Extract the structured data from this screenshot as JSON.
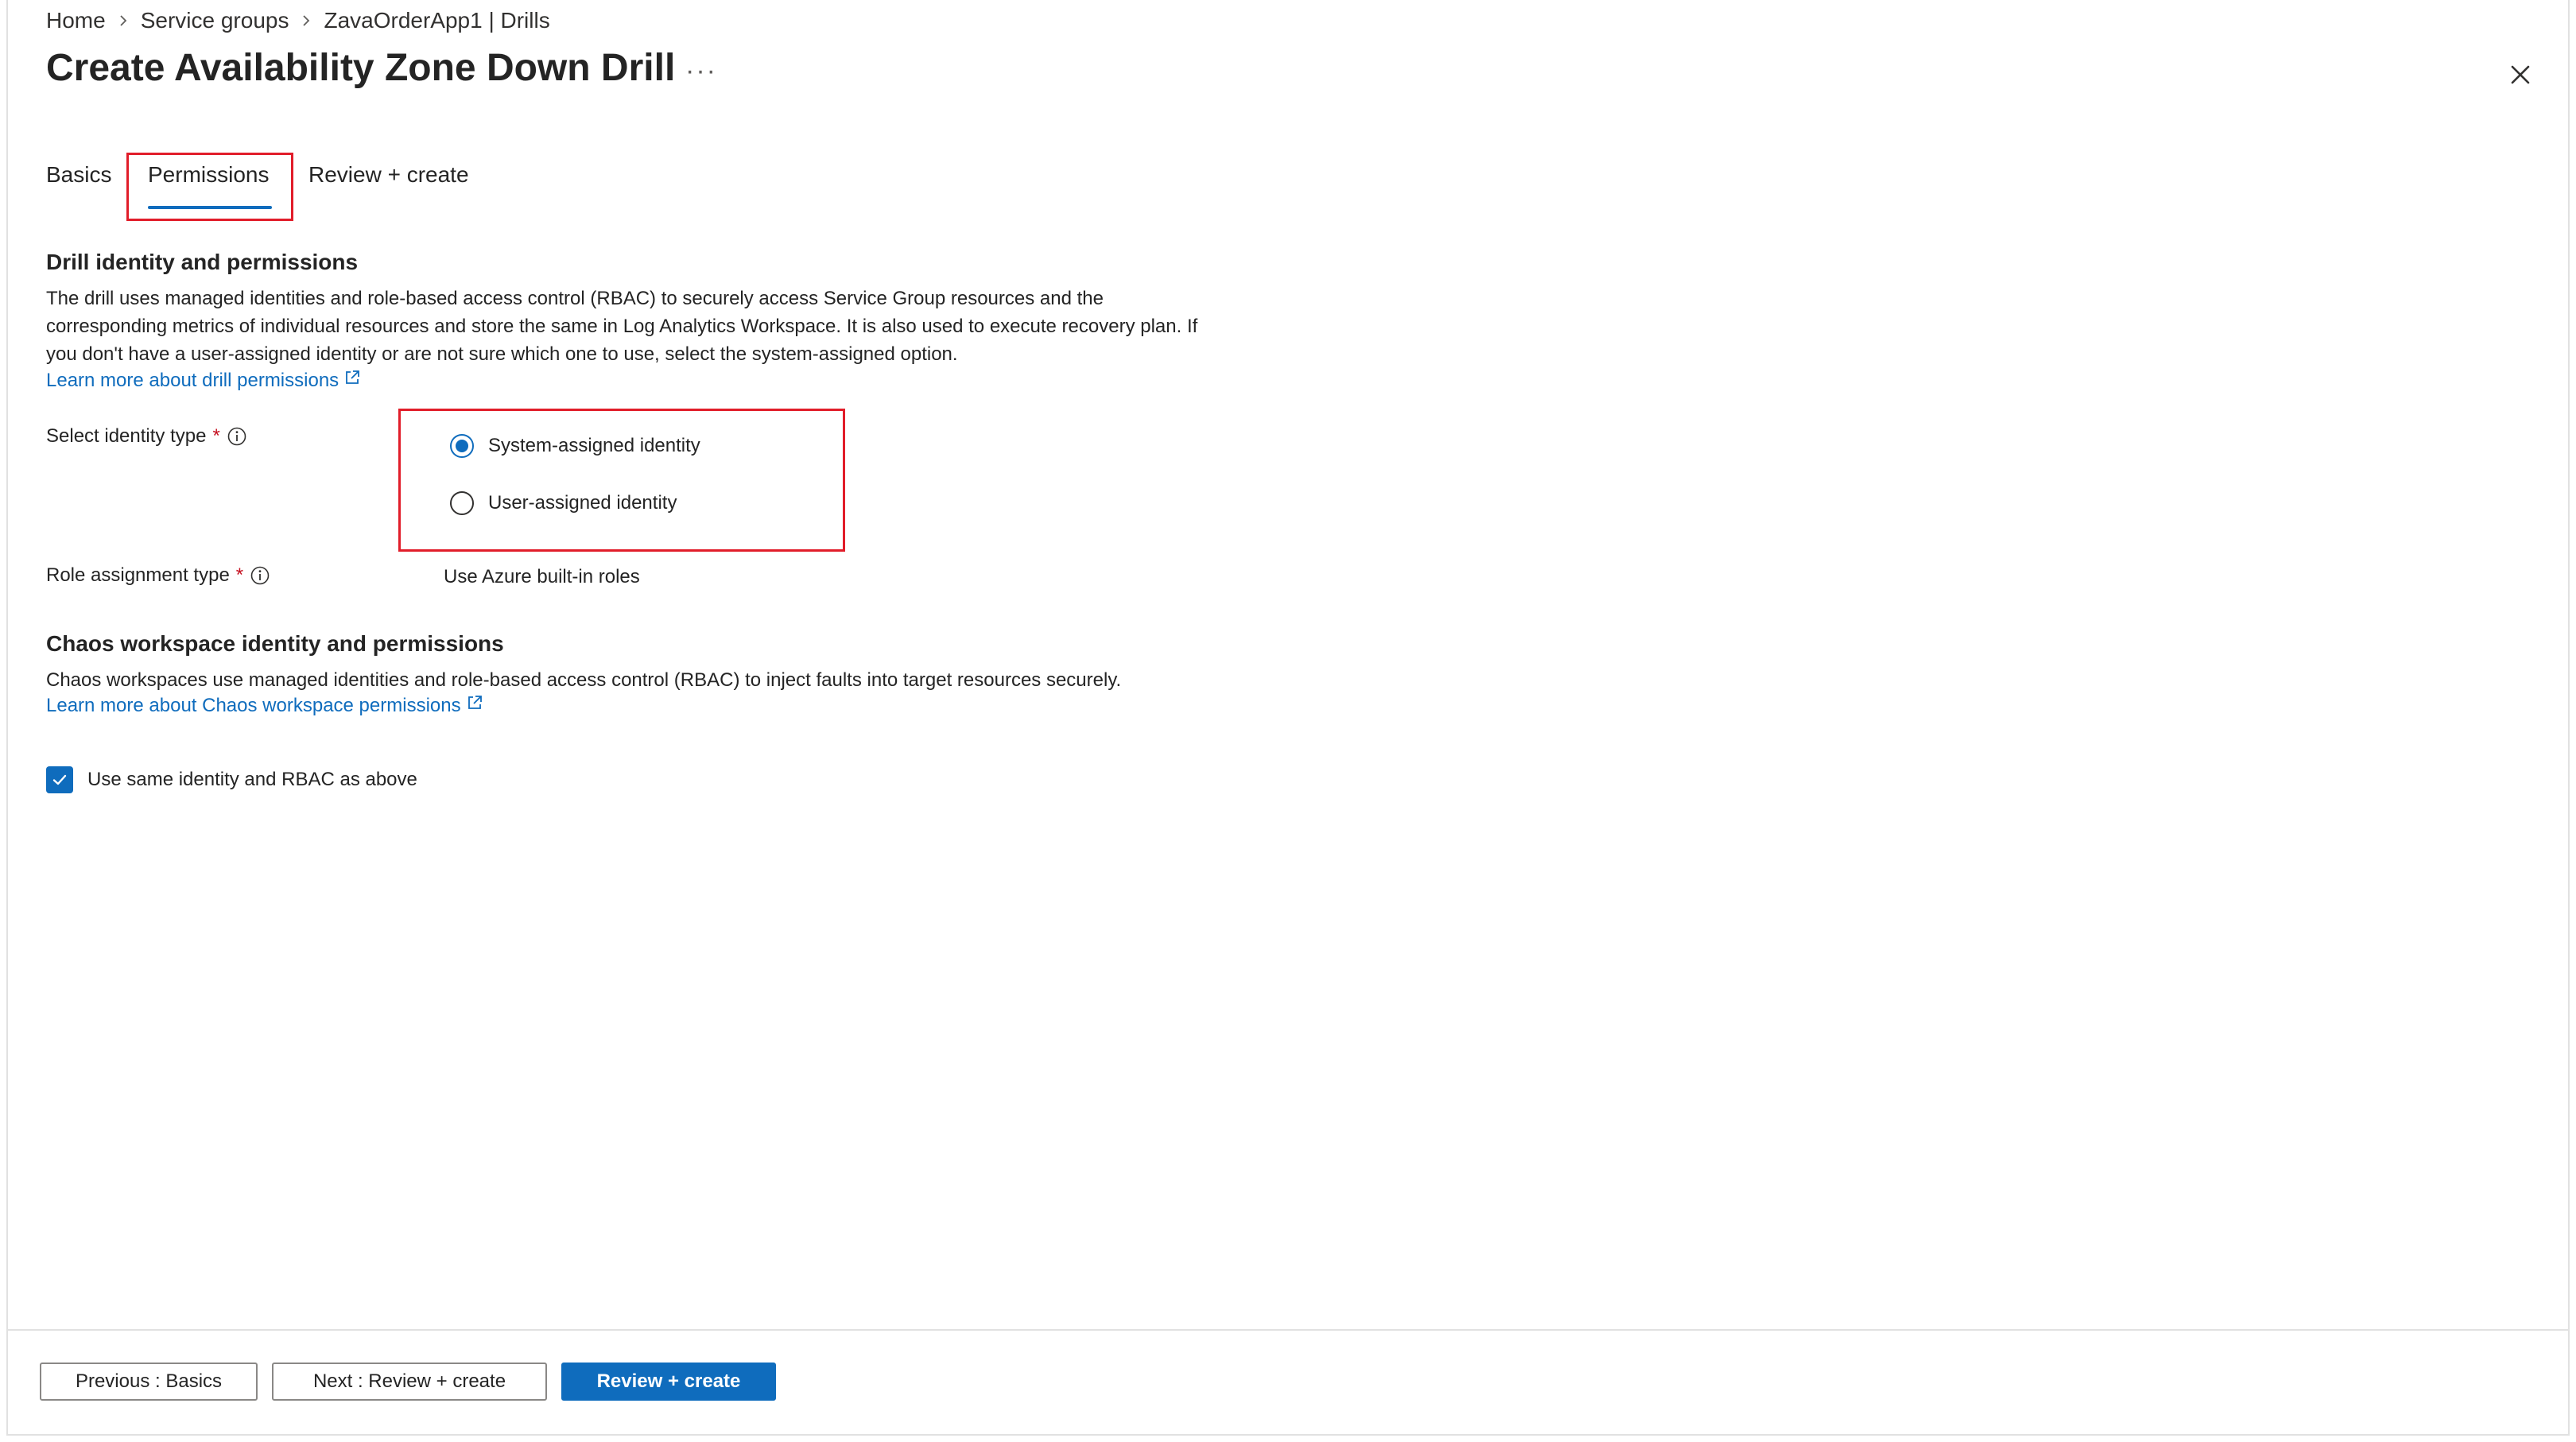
{
  "breadcrumb": [
    "Home",
    "Service groups",
    "ZavaOrderApp1 | Drills"
  ],
  "page_title": "Create Availability Zone Down Drill",
  "more_label": "···",
  "tabs": [
    {
      "label": "Basics",
      "selected": false
    },
    {
      "label": "Permissions",
      "selected": true
    },
    {
      "label": "Review + create",
      "selected": false
    }
  ],
  "drill_section": {
    "title": "Drill identity and permissions",
    "description": "The drill uses managed identities and role-based access control (RBAC) to securely access Service Group resources and the corresponding metrics of individual resources and store the same in Log Analytics Workspace. It is also used to execute recovery plan. If you don't have a user-assigned identity or are not sure which one to use, select the system-assigned option.",
    "link": "Learn more about drill permissions"
  },
  "identity_field": {
    "label": "Select identity type",
    "required_mark": "*",
    "options": [
      {
        "label": "System-assigned identity",
        "checked": true
      },
      {
        "label": "User-assigned identity",
        "checked": false
      }
    ]
  },
  "role_field": {
    "label": "Role assignment type",
    "required_mark": "*",
    "value": "Use Azure built-in roles"
  },
  "chaos_section": {
    "title": "Chaos workspace identity and permissions",
    "description": "Chaos workspaces use managed identities and role-based access control (RBAC) to inject faults into target resources securely.",
    "link": "Learn more about Chaos workspace permissions"
  },
  "same_identity_checkbox": {
    "label": "Use same identity and RBAC as above",
    "checked": true
  },
  "footer": {
    "previous_label": "Previous : Basics",
    "next_label": "Next : Review + create",
    "review_label": "Review + create"
  },
  "colors": {
    "accent": "#0f6cbd",
    "highlight": "#e11d2a",
    "required": "#c50f1f"
  }
}
